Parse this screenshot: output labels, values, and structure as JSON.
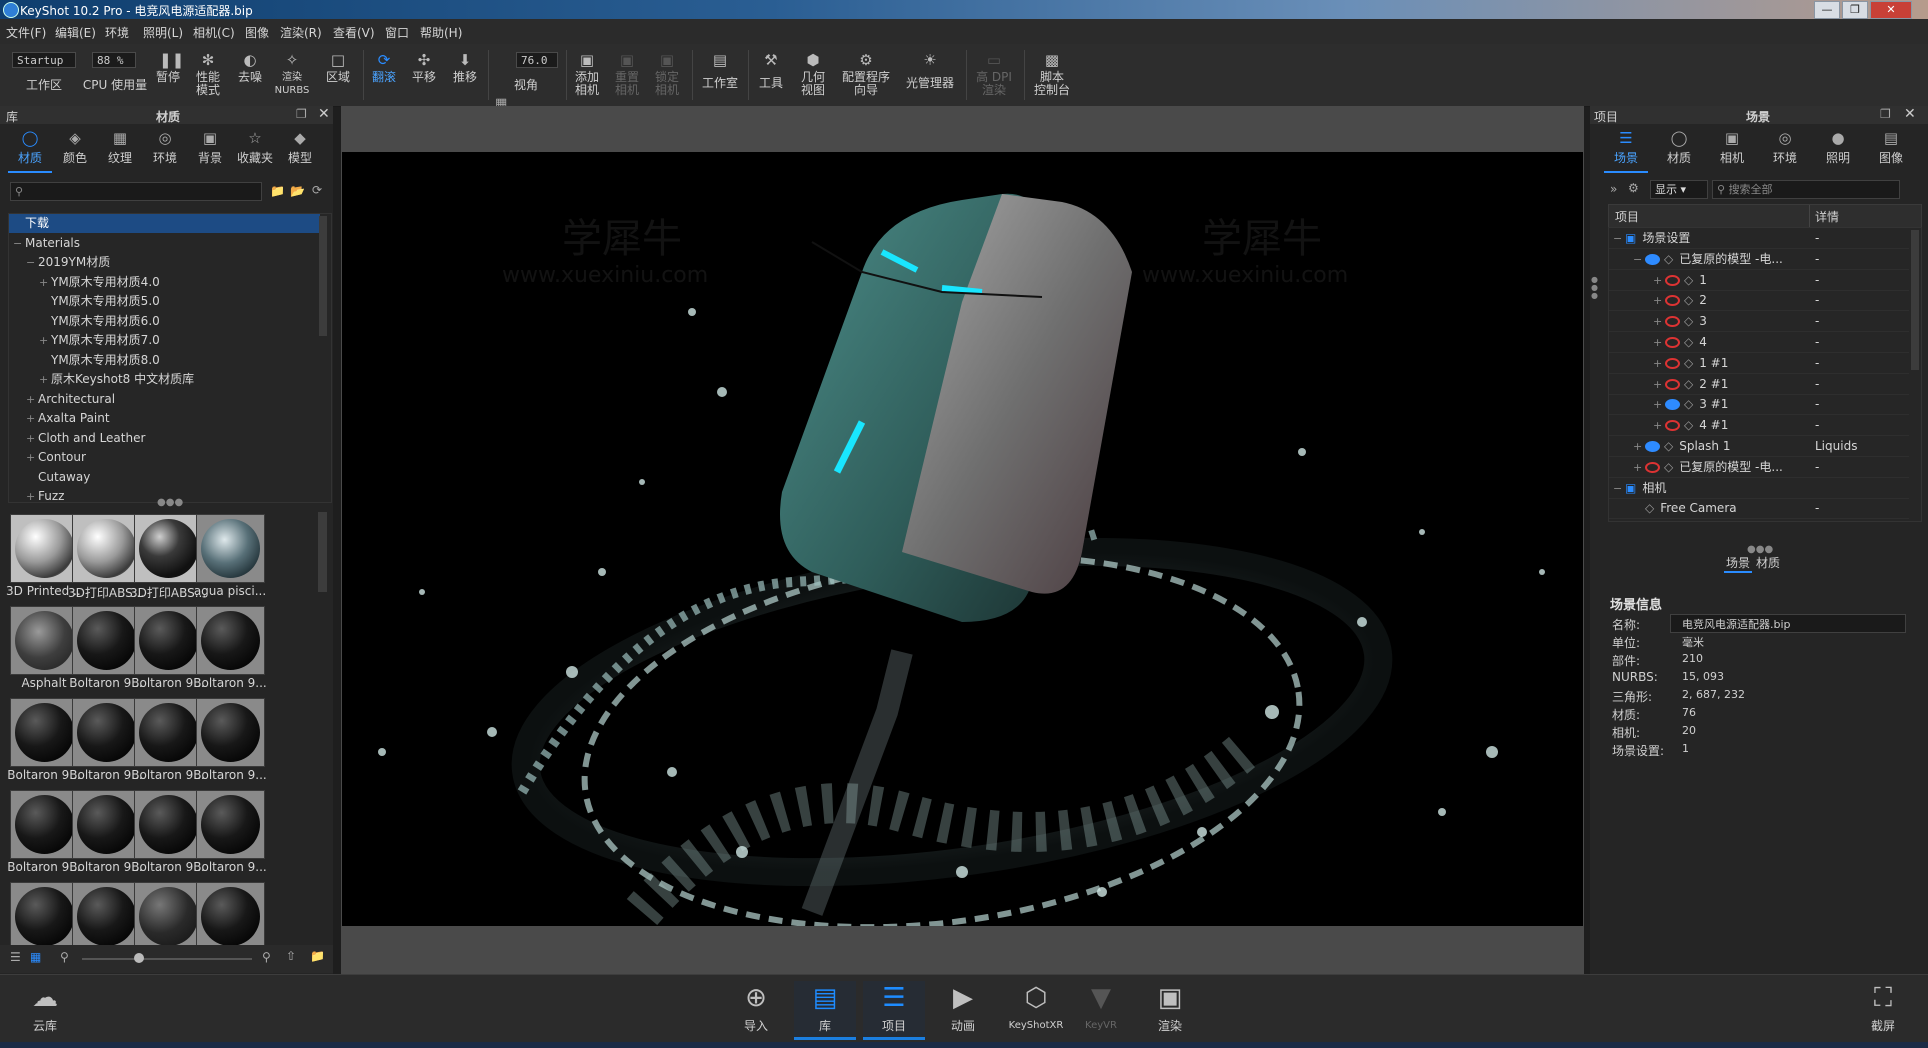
{
  "window": {
    "title": "KeyShot 10.2 Pro  - 电竞风电源适配器.bip"
  },
  "menu": [
    "文件(F)",
    "编辑(E)",
    "环境",
    "照明(L)",
    "相机(C)",
    "图像",
    "渲染(R)",
    "查看(V)",
    "窗口",
    "帮助(H)"
  ],
  "toolbar": {
    "workspace_value": "Startup",
    "workspace_label": "工作区",
    "cpu_value": "88 %",
    "cpu_label": "CPU 使用量",
    "pause": "暂停",
    "perf_mode": "性能\n模式",
    "denoise": "去噪",
    "render_nurbs": "渲染\nNURBS",
    "region": "区域",
    "tumble": "翻滚",
    "pan": "平移",
    "dolly": "推移",
    "fov_value": "76.0",
    "fov_label": "视角",
    "add_camera": "添加\n相机",
    "reset_camera": "重置\n相机",
    "lock_camera": "锁定\n相机",
    "studio": "工作室",
    "tools": "工具",
    "geometry_view": "几何\n视图",
    "config_wizard": "配置程序\n向导",
    "light_manager": "光管理器",
    "high_dpi": "高 DPI\n渲染",
    "script_console": "脚本\n控制台"
  },
  "library": {
    "panel_left": "库",
    "panel_title": "材质",
    "tabs": [
      "材质",
      "颜色",
      "纹理",
      "环境",
      "背景",
      "收藏夹",
      "模型"
    ],
    "tree": [
      {
        "label": "下载",
        "level": 0,
        "toggle": "",
        "selected": true
      },
      {
        "label": "Materials",
        "level": 0,
        "toggle": "−"
      },
      {
        "label": "2019YM材质",
        "level": 1,
        "toggle": "−"
      },
      {
        "label": "YM原木专用材质4.0",
        "level": 2,
        "toggle": "+"
      },
      {
        "label": "YM原木专用材质5.0",
        "level": 2,
        "toggle": ""
      },
      {
        "label": "YM原木专用材质6.0",
        "level": 2,
        "toggle": ""
      },
      {
        "label": "YM原木专用材质7.0",
        "level": 2,
        "toggle": "+"
      },
      {
        "label": "YM原木专用材质8.0",
        "level": 2,
        "toggle": ""
      },
      {
        "label": "原木Keyshot8 中文材质库",
        "level": 2,
        "toggle": "+"
      },
      {
        "label": "Architectural",
        "level": 1,
        "toggle": "+"
      },
      {
        "label": "Axalta Paint",
        "level": 1,
        "toggle": "+"
      },
      {
        "label": "Cloth and Leather",
        "level": 1,
        "toggle": "+"
      },
      {
        "label": "Contour",
        "level": 1,
        "toggle": "+"
      },
      {
        "label": "Cutaway",
        "level": 1,
        "toggle": ""
      },
      {
        "label": "Fuzz",
        "level": 1,
        "toggle": "+"
      }
    ],
    "thumbs": [
      {
        "caption": "3D Printed ...",
        "kind": "chrome"
      },
      {
        "caption": "3D打印ABS...",
        "kind": "chrome"
      },
      {
        "caption": "3D打印ABS...",
        "kind": "dark"
      },
      {
        "caption": "agua pisci...",
        "kind": "water"
      },
      {
        "caption": "Asphalt",
        "kind": "asphalt"
      },
      {
        "caption": "Boltaron 9...",
        "kind": "black"
      },
      {
        "caption": "Boltaron 9...",
        "kind": "black"
      },
      {
        "caption": "Boltaron 9...",
        "kind": "black"
      },
      {
        "caption": "Boltaron 9...",
        "kind": "black"
      },
      {
        "caption": "Boltaron 9...",
        "kind": "black"
      },
      {
        "caption": "Boltaron 9...",
        "kind": "black"
      },
      {
        "caption": "Boltaron 9...",
        "kind": "black"
      },
      {
        "caption": "Boltaron 9...",
        "kind": "black"
      },
      {
        "caption": "Boltaron 9...",
        "kind": "black"
      },
      {
        "caption": "Boltaron 9...",
        "kind": "black"
      },
      {
        "caption": "Boltaron 9...",
        "kind": "black"
      },
      {
        "caption": "",
        "kind": "black"
      },
      {
        "caption": "",
        "kind": "black"
      },
      {
        "caption": "",
        "kind": "pattern"
      },
      {
        "caption": "",
        "kind": "black"
      }
    ]
  },
  "viewport": {
    "watermark_cn": "学犀牛",
    "watermark_url": "www.xuexiniu.com"
  },
  "project": {
    "panel_left": "项目",
    "panel_title": "场景",
    "tabs": [
      "场景",
      "材质",
      "相机",
      "环境",
      "照明",
      "图像"
    ],
    "filter_label": "显示",
    "search_placeholder": "搜索全部",
    "col_item": "项目",
    "col_detail": "详情",
    "tree": [
      {
        "label": "场景设置",
        "detail": "-",
        "level": 0,
        "toggle": "−",
        "eye": ""
      },
      {
        "label": "已复原的模型 -电...",
        "detail": "-",
        "level": 1,
        "toggle": "−",
        "eye": "on"
      },
      {
        "label": "1",
        "detail": "-",
        "level": 2,
        "toggle": "+",
        "eye": "off"
      },
      {
        "label": "2",
        "detail": "-",
        "level": 2,
        "toggle": "+",
        "eye": "off"
      },
      {
        "label": "3",
        "detail": "-",
        "level": 2,
        "toggle": "+",
        "eye": "off"
      },
      {
        "label": "4",
        "detail": "-",
        "level": 2,
        "toggle": "+",
        "eye": "off"
      },
      {
        "label": "1 #1",
        "detail": "-",
        "level": 2,
        "toggle": "+",
        "eye": "off"
      },
      {
        "label": "2 #1",
        "detail": "-",
        "level": 2,
        "toggle": "+",
        "eye": "off"
      },
      {
        "label": "3 #1",
        "detail": "-",
        "level": 2,
        "toggle": "+",
        "eye": "on"
      },
      {
        "label": "4 #1",
        "detail": "-",
        "level": 2,
        "toggle": "+",
        "eye": "off"
      },
      {
        "label": "Splash 1",
        "detail": "Liquids",
        "level": 1,
        "toggle": "+",
        "eye": "on"
      },
      {
        "label": "已复原的模型 -电...",
        "detail": "-",
        "level": 1,
        "toggle": "+",
        "eye": "off"
      },
      {
        "label": "相机",
        "detail": "",
        "level": 0,
        "toggle": "−",
        "eye": ""
      },
      {
        "label": "Free Camera",
        "detail": "-",
        "level": 1,
        "toggle": "",
        "eye": ""
      }
    ],
    "sub_tabs": [
      "场景",
      "材质"
    ],
    "info_title": "场景信息",
    "info": [
      {
        "k": "名称:",
        "v": "电竞风电源适配器.bip"
      },
      {
        "k": "单位:",
        "v": "毫米"
      },
      {
        "k": "部件:",
        "v": "210"
      },
      {
        "k": "NURBS:",
        "v": "15, 093"
      },
      {
        "k": "三角形:",
        "v": "2, 687, 232"
      },
      {
        "k": "材质:",
        "v": "76"
      },
      {
        "k": "相机:",
        "v": "20"
      },
      {
        "k": "场景设置:",
        "v": "1"
      }
    ]
  },
  "bottom": {
    "cloud": "云库",
    "import": "导入",
    "library": "库",
    "project": "项目",
    "animation": "动画",
    "keyshotxr": "KeyShotXR",
    "keyve": "KeyVR",
    "render": "渲染",
    "screenshot": "截屏"
  },
  "colors": {
    "accent": "#2a8cff",
    "selection": "#1d4b84",
    "led": "#19e6ff"
  }
}
